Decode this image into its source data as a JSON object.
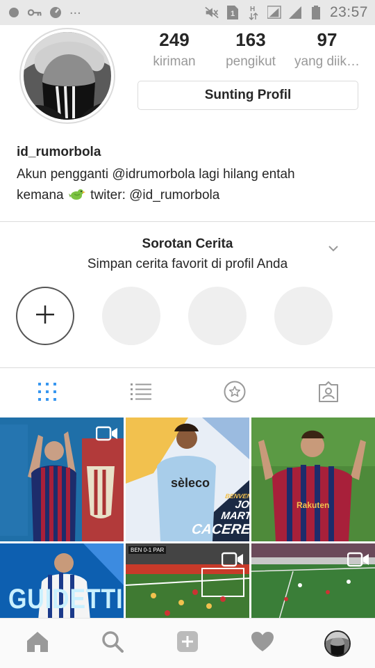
{
  "status_bar": {
    "time": "23:57",
    "overflow": "...",
    "icons_left": [
      "notification-dot-icon",
      "key-icon",
      "dashboard-icon"
    ],
    "icons_right": [
      "mute-icon",
      "sim1-icon",
      "data-h-icon",
      "signal-sim1-icon",
      "signal-sim2-icon",
      "battery-icon"
    ]
  },
  "profile": {
    "username": "id_rumorbola",
    "bio_line1": "Akun pengganti @idrumorbola lagi hilang entah",
    "bio_line2_prefix": "kemana",
    "bio_line2_suffix": "twiter: @id_rumorbola",
    "bio_emoji_icon": "bird-icon",
    "edit_button": "Sunting Profil",
    "stats": [
      {
        "value": "249",
        "label": "kiriman"
      },
      {
        "value": "163",
        "label": "pengikut"
      },
      {
        "value": "97",
        "label": "yang diik…"
      }
    ]
  },
  "highlights": {
    "title": "Sorotan Cerita",
    "subtitle": "Simpan cerita favorit di profil Anda",
    "new_icon": "plus-icon",
    "empty_count": 3
  },
  "tabs": [
    {
      "name": "grid",
      "icon": "grid-icon",
      "active": true
    },
    {
      "name": "list",
      "icon": "list-icon",
      "active": false
    },
    {
      "name": "saved",
      "icon": "star-icon",
      "active": false
    },
    {
      "name": "tagged",
      "icon": "tagged-icon",
      "active": false
    }
  ],
  "posts": [
    {
      "alt": "barcelona-player",
      "video": true
    },
    {
      "alt": "lazio-caceres",
      "text_top": "BENVENUTO",
      "text_main1": "JOSE MARTIN",
      "text_main2": "CACERES",
      "video": false
    },
    {
      "alt": "barcelona-celebration",
      "video": false
    },
    {
      "alt": "guidetti",
      "text_main1": "GUIDETTI",
      "video": false
    },
    {
      "alt": "match-goal",
      "score": "BEN 0-1 PAR",
      "video": true
    },
    {
      "alt": "match-field",
      "video": true
    }
  ],
  "bottom_nav": [
    "home-icon",
    "search-icon",
    "add-icon",
    "heart-icon",
    "profile-icon"
  ],
  "colors": {
    "accent": "#3897f0",
    "text": "#262626",
    "muted": "#999999",
    "border": "#dbdbdb"
  }
}
